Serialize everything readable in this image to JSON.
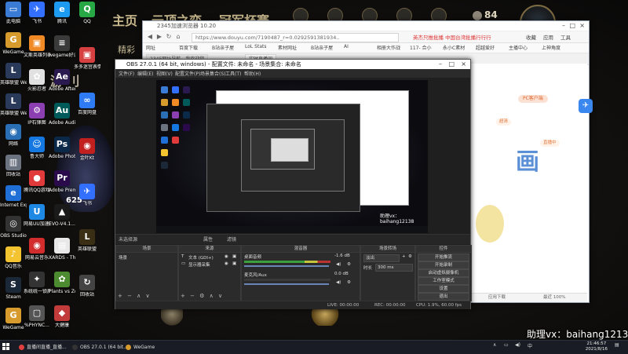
{
  "background_game": {
    "nav_words": [
      "主页",
      "云顶之弈",
      "冠军杯赛"
    ],
    "coins": "84",
    "sidebar_words": "精彩",
    "badge_number": "625"
  },
  "desktop_icons": [
    {
      "label": "此电脑",
      "color": "#3a7bd5",
      "glyph": "▭"
    },
    {
      "label": "WeGame",
      "color": "#d69a2d",
      "glyph": "G"
    },
    {
      "label": "英雄联盟 WeGame版",
      "color": "#2a3a5a",
      "glyph": "L"
    },
    {
      "label": "英雄联盟 WeGame版",
      "color": "#2a3a5a",
      "glyph": "L"
    },
    {
      "label": "网络",
      "color": "#2a6fb5",
      "glyph": "◉"
    },
    {
      "label": "回收站",
      "color": "#6b7280",
      "glyph": "▥"
    },
    {
      "label": "Internet Explorer",
      "color": "#1f6fd6",
      "glyph": "e"
    },
    {
      "label": "OBS Studio",
      "color": "#333333",
      "glyph": "◎"
    },
    {
      "label": "QQ音乐",
      "color": "#f4c430",
      "glyph": "♪"
    },
    {
      "label": "Steam",
      "color": "#1b2838",
      "glyph": "S"
    },
    {
      "label": "WeGame",
      "color": "#d69a2d",
      "glyph": "G"
    }
  ],
  "desktop_icons_col2": [
    {
      "label": "飞书",
      "color": "#3370ff",
      "glyph": "✈"
    },
    {
      "label": "文斯英雄列表(YN4OC)",
      "color": "#f08a24",
      "glyph": "▣"
    },
    {
      "label": "火影忍者",
      "color": "#e1e1e1",
      "glyph": "✿"
    },
    {
      "label": "IP石锋图",
      "color": "#8b3fb0",
      "glyph": "⚙"
    },
    {
      "label": "鲁大师",
      "color": "#1478e0",
      "glyph": "☺"
    },
    {
      "label": "腾讯QQ游戏",
      "color": "#e03a3a",
      "glyph": "●"
    },
    {
      "label": "网易UU加速器",
      "color": "#1e88e5",
      "glyph": "U"
    },
    {
      "label": "网易云音乐",
      "color": "#d22c2c",
      "glyph": "◉"
    },
    {
      "label": "系统统一锁屏面板",
      "color": "#333333",
      "glyph": "✦"
    },
    {
      "label": "%PHYNC...",
      "color": "#555555",
      "glyph": "▢"
    }
  ],
  "desktop_icons_col3": [
    {
      "label": "腾讯",
      "color": "#1d9bf0",
      "glyph": "e"
    },
    {
      "label": "wegame好设置",
      "color": "#3a3a3a",
      "glyph": "≡"
    },
    {
      "label": "Adobe After Effects 2020",
      "color": "#2b1a4f",
      "glyph": "Ae"
    },
    {
      "label": "Adobe Audition",
      "color": "#005a5a",
      "glyph": "Au"
    },
    {
      "label": "Adobe Photosh...",
      "color": "#0b2a4a",
      "glyph": "Ps"
    },
    {
      "label": "Adobe Premiere",
      "color": "#2a0a4a",
      "glyph": "Pr"
    },
    {
      "label": "EVO-V4.1...",
      "color": "#1a1a1a",
      "glyph": "▲"
    },
    {
      "label": "XARDS - The WWII...",
      "color": "#e8e8e8",
      "glyph": "▤"
    },
    {
      "label": "Plants vs Zombies G...",
      "color": "#4c8b2f",
      "glyph": "✿"
    },
    {
      "label": "大健康",
      "color": "#c23b3b",
      "glyph": "◆"
    }
  ],
  "desktop_icons_col4": [
    {
      "label": "QQ",
      "color": "#28a745",
      "glyph": "Q"
    },
    {
      "label": "多多迷宫表情包",
      "color": "#d64040",
      "glyph": "▣"
    },
    {
      "label": "百度网盘",
      "color": "#2f7bf5",
      "glyph": "∞"
    },
    {
      "label": "金叶Kt",
      "color": "#c21f1f",
      "glyph": "◉"
    },
    {
      "label": "飞书",
      "color": "#3370ff",
      "glyph": "✈"
    },
    {
      "label": "英雄联盟",
      "color": "#3a2e14",
      "glyph": "L"
    },
    {
      "label": "回收站",
      "color": "#444444",
      "glyph": "↻"
    }
  ],
  "browser": {
    "title": "2345加速浏览器 10.20",
    "url": "https://www.douyu.com/7190487_r=0.0292591381934..",
    "news": "英杰只推批播 中国台湾批播行行行",
    "menu": [
      "收藏",
      "应用",
      "工具"
    ],
    "favorites": [
      "网址",
      "百度下载",
      "B站亲子屋",
      "LoL Stats",
      "素材网址",
      "B站亲子屋",
      "AI ",
      "相册大作战",
      "117- 合小",
      "永小C素材",
      "超越爱好",
      "主播中心",
      "上神角度"
    ],
    "tabs": [
      "2345网址导航 - 我欢迎您",
      "实时直播间"
    ],
    "page_pill": "PC客户端",
    "page_chip1": "超清",
    "page_chip2": "直播中",
    "page_bignum": "画",
    "status_left": "应用下载",
    "status_right": "最近 100%"
  },
  "obs": {
    "title": "OBS 27.0.1 (64 bit, windows) - 配置文件: 未命名 - 场景集合: 未命名",
    "menu": [
      "文件(F)",
      "编辑(E)",
      "视图(V)",
      "配置文件(P)",
      "场景集合(S)",
      "工具(T)",
      "帮助(H)"
    ],
    "scene_bar_label": "未选择源",
    "scene_bar_props": "属性",
    "scene_bar_filters": "滤镜",
    "docks": {
      "scenes": {
        "header": "场景",
        "items": [
          "场景"
        ]
      },
      "sources": {
        "header": "来源",
        "items": [
          "文本 (GDI+)",
          "显示器采集"
        ]
      },
      "mixer": {
        "header": "混音器",
        "tracks": [
          "桌面音频",
          "麦克风/Aux"
        ],
        "levels": [
          "-1.6 dB",
          "0.0 dB"
        ]
      },
      "transitions": {
        "header": "场景转场",
        "type": "淡出",
        "duration_label": "时长",
        "duration": "300 ms"
      },
      "controls": {
        "header": "控件",
        "buttons": [
          "开始推流",
          "开始录制",
          "启动虚拟摄像机",
          "工作室模式",
          "设置",
          "退出"
        ]
      }
    },
    "status": {
      "live": "LIVE: 00:00:00",
      "rec": "REC: 00:00:00",
      "cpu": "CPU: 1.9%, 60.00 fps"
    },
    "preview_watermark": "助理vx：baihang12138"
  },
  "watermark": "助理vx：baihang12138",
  "taskbar": {
    "items": [
      {
        "label": "直播间直播_直播...",
        "color": "#e04040"
      },
      {
        "label": "OBS 27.0.1 (64 bit...",
        "color": "#333333"
      },
      {
        "label": "WeGame",
        "color": "#d69a2d"
      }
    ],
    "tray_lang": "中",
    "time": "21:46:57",
    "date": "2021/8/16"
  }
}
